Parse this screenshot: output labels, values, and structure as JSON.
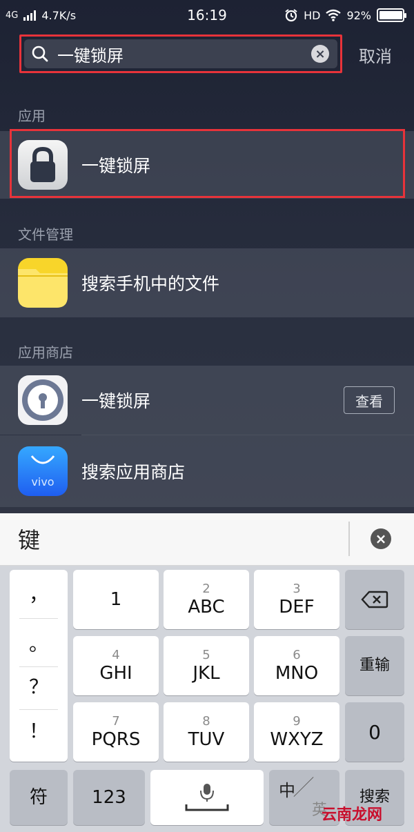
{
  "status_bar": {
    "network": "4G",
    "speed": "4.7K/s",
    "time": "16:19",
    "hd": "HD",
    "battery": "92%"
  },
  "search": {
    "value": "一键锁屏",
    "cancel_label": "取消"
  },
  "sections": {
    "apps_title": "应用",
    "app_result_label": "一键锁屏",
    "files_title": "文件管理",
    "files_search_label": "搜索手机中的文件",
    "store_title": "应用商店",
    "store_result_label": "一键锁屏",
    "store_view_label": "查看",
    "store_search_label": "搜索应用商店",
    "vivo_text": "vivo"
  },
  "keyboard": {
    "composition": "键",
    "punctuation": [
      "，",
      "。",
      "？",
      "！"
    ],
    "keys": [
      {
        "num": "",
        "letters": "1"
      },
      {
        "num": "2",
        "letters": "ABC"
      },
      {
        "num": "3",
        "letters": "DEF"
      },
      {
        "num": "4",
        "letters": "GHI"
      },
      {
        "num": "5",
        "letters": "JKL"
      },
      {
        "num": "6",
        "letters": "MNO"
      },
      {
        "num": "7",
        "letters": "PQRS"
      },
      {
        "num": "8",
        "letters": "TUV"
      },
      {
        "num": "9",
        "letters": "WXYZ"
      }
    ],
    "reinput_label": "重输",
    "zero_label": "0",
    "symbol_label": "符",
    "numeric_label": "123",
    "lang_label_top": "中",
    "lang_label_bottom": "英",
    "search_label": "搜索"
  },
  "watermark": "云南龙网",
  "colors": {
    "highlight": "#e8333a",
    "folder": "#f8d52a",
    "vivo_blue": "#2a6df5"
  }
}
